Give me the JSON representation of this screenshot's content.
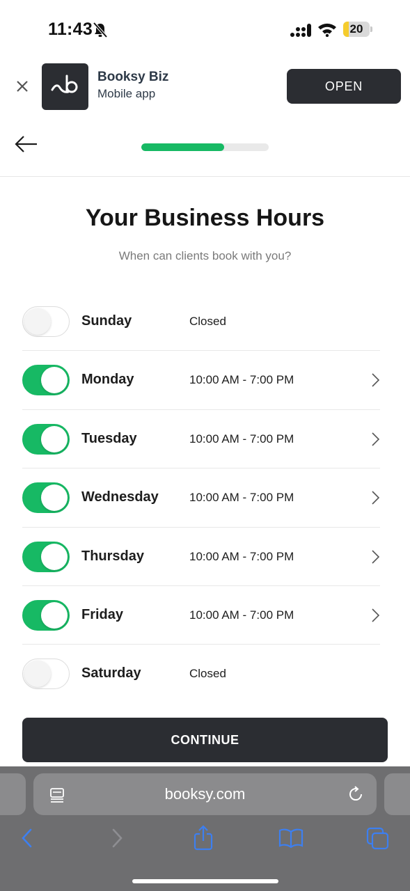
{
  "status_bar": {
    "time": "11:43",
    "battery": "20",
    "battery_level": 0.2,
    "icons": [
      "bell-muted-icon",
      "signal-icon",
      "wifi-icon",
      "battery-icon"
    ]
  },
  "app_banner": {
    "app_name": "Booksy Biz",
    "app_subtitle": "Mobile app",
    "open_label": "OPEN"
  },
  "progress": {
    "value": 0.65,
    "color": "#17b964"
  },
  "page": {
    "title": "Your Business Hours",
    "subtitle": "When can clients book with you?"
  },
  "days": [
    {
      "name": "Sunday",
      "enabled": false,
      "hours": "Closed"
    },
    {
      "name": "Monday",
      "enabled": true,
      "hours": "10:00 AM - 7:00 PM"
    },
    {
      "name": "Tuesday",
      "enabled": true,
      "hours": "10:00 AM - 7:00 PM"
    },
    {
      "name": "Wednesday",
      "enabled": true,
      "hours": "10:00 AM - 7:00 PM"
    },
    {
      "name": "Thursday",
      "enabled": true,
      "hours": "10:00 AM - 7:00 PM"
    },
    {
      "name": "Friday",
      "enabled": true,
      "hours": "10:00 AM - 7:00 PM"
    },
    {
      "name": "Saturday",
      "enabled": false,
      "hours": "Closed"
    }
  ],
  "continue_label": "CONTINUE",
  "browser": {
    "url": "booksy.com",
    "toolbar_icons": [
      "back-icon",
      "forward-icon",
      "share-icon",
      "bookmarks-icon",
      "tabs-icon"
    ]
  },
  "colors": {
    "accent_green": "#17b964",
    "dark_button": "#2b2d32",
    "toolbar_blue": "#3d7ff0"
  }
}
